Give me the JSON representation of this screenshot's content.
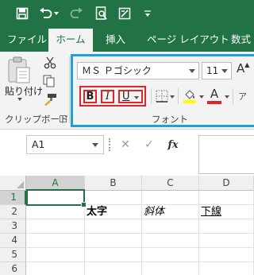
{
  "quick_access": {
    "icons": [
      "save-icon",
      "undo-icon",
      "redo-icon",
      "print-preview-icon",
      "form-icon",
      "customize-icon"
    ]
  },
  "tabs": [
    {
      "label": "ファイル",
      "active": false
    },
    {
      "label": "ホーム",
      "active": true
    },
    {
      "label": "挿入",
      "active": false
    },
    {
      "label": "ページ レイアウト",
      "active": false
    },
    {
      "label": "数式",
      "active": false
    }
  ],
  "clipboard": {
    "paste_label": "貼り付け",
    "group_label": "クリップボード"
  },
  "font_group": {
    "font_name": "ＭＳ Ｐゴシック",
    "font_size": "11",
    "bold_label": "B",
    "italic_label": "I",
    "underline_label": "U",
    "grow_font_label": "A",
    "font_color_label": "A",
    "group_label": "フォント",
    "highlight_color": "#ffff00",
    "font_color": "#e1242c"
  },
  "formula_bar": {
    "name_box": "A1",
    "cancel_symbol": "✕",
    "enter_symbol": "✓",
    "fx_symbol": "fx"
  },
  "sheet": {
    "columns": [
      "A",
      "B",
      "C",
      "D"
    ],
    "rows": [
      "1",
      "2",
      "3",
      "4",
      "5",
      "6"
    ],
    "selected_cell": "A1",
    "cells": {
      "B2": "太字",
      "C2": "斜体",
      "D2": "下線"
    }
  },
  "colors": {
    "accent": "#217346",
    "highlight_frame": "#1d9fe0",
    "annotation_red": "#e1242c"
  }
}
